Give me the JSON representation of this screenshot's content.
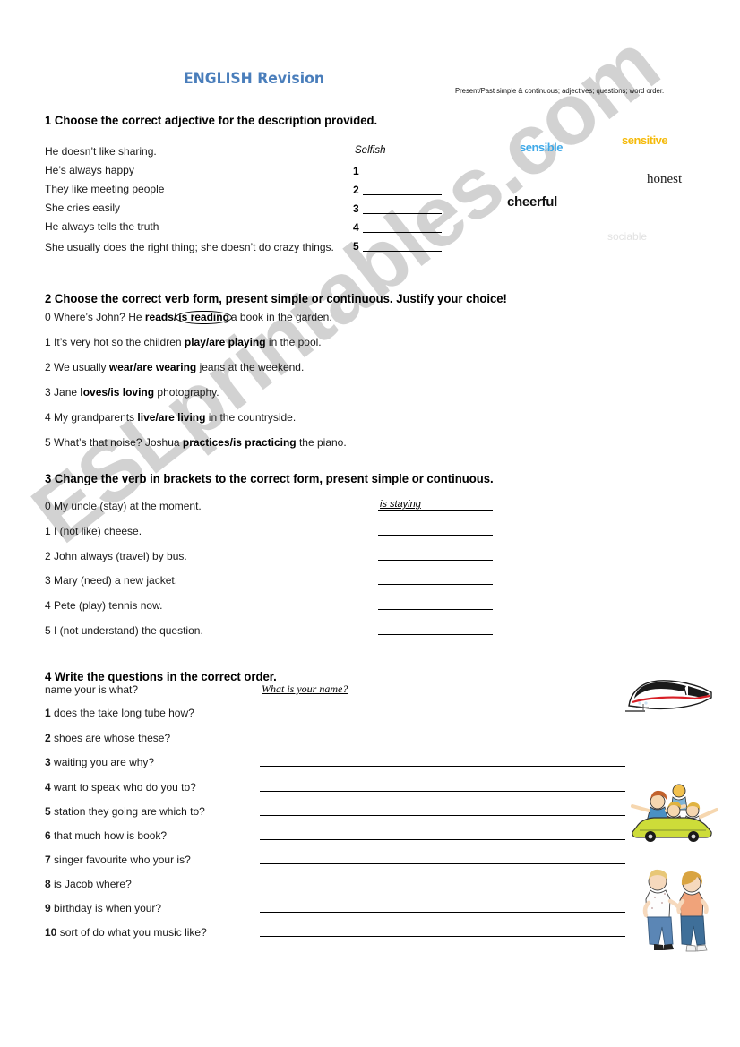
{
  "header": {
    "title": "ENGLISH Revision",
    "subtitle": "Present/Past simple & continuous; adjectives; questions; word order.",
    "title_color": "#4a7ebb"
  },
  "watermark": {
    "text": "ESLprintables.com",
    "color": "#d2d2d2"
  },
  "exercise1": {
    "heading": "1 Choose the correct adjective for the description provided.",
    "prompts": [
      "He doesn’t like sharing.",
      "He’s always happy",
      "They like meeting people",
      "She cries easily",
      "He always tells the truth",
      "She usually does the right thing; she doesn’t do crazy things."
    ],
    "example_answer": "Selfish",
    "answer_numbers": [
      "1",
      "2",
      "3",
      "4",
      "5"
    ],
    "wordbank": [
      {
        "word": "sensible",
        "color": "#3fa9e8"
      },
      {
        "word": "sensitive",
        "color": "#f5ba0a"
      },
      {
        "word": "honest",
        "color": "#1a1a1a"
      },
      {
        "word": "cheerful",
        "color": "#111111"
      },
      {
        "word": "sociable",
        "color": "#e2e2e2"
      }
    ]
  },
  "exercise2": {
    "heading": "2 Choose the correct verb form, present simple or continuous.  Justify your choice!",
    "items": [
      {
        "num": "0",
        "pre": "Where’s John? He ",
        "opt_a": "reads/",
        "opt_b": "is reading",
        "post": "a book in the garden.",
        "circled": true
      },
      {
        "num": "1",
        "pre": "It’s very hot so the children ",
        "opt_a": "play/are playing",
        "opt_b": "",
        "post": " in the pool.",
        "circled": false
      },
      {
        "num": "2",
        "pre": "We usually ",
        "opt_a": "wear/are wearing",
        "opt_b": "",
        "post": " jeans at the weekend.",
        "circled": false
      },
      {
        "num": "3",
        "pre": "Jane ",
        "opt_a": "loves/is loving",
        "opt_b": "",
        "post": " photography.",
        "circled": false
      },
      {
        "num": "4",
        "pre": "My grandparents ",
        "opt_a": "live/are living",
        "opt_b": "",
        "post": " in the countryside.",
        "circled": false
      },
      {
        "num": "5",
        "pre": "What’s that noise? Joshua ",
        "opt_a": "practices/is practicing",
        "opt_b": "",
        "post": " the piano.",
        "circled": false
      }
    ]
  },
  "exercise3": {
    "heading": "3 Change the verb in brackets to the correct form, present simple or continuous.",
    "items": [
      "0 My uncle (stay) at the moment.",
      "1 I (not like) cheese.",
      "2 John always (travel) by bus.",
      "3 Mary (need) a new jacket.",
      "4 Pete (play) tennis now.",
      "5 I (not understand) the question."
    ],
    "example_answer": "is staying"
  },
  "exercise4": {
    "heading": "4 Write the questions in the correct order.",
    "example_prompt": "name your is what?",
    "example_answer": "What is your name?",
    "items": [
      {
        "num": "1",
        "text": "does the take long tube how?"
      },
      {
        "num": "2",
        "text": "shoes are whose these?"
      },
      {
        "num": "3",
        "text": "waiting you are why?"
      },
      {
        "num": "4",
        "text": "want to speak who do you to?"
      },
      {
        "num": "5",
        "text": "station they going are which to?"
      },
      {
        "num": "6",
        "text": "that much how is book?"
      },
      {
        "num": "7",
        "text": "singer favourite who your is?"
      },
      {
        "num": "8",
        "text": "is Jacob where?"
      },
      {
        "num": "9",
        "text": "birthday is when your?"
      },
      {
        "num": "10",
        "text": "sort of do what you music like?"
      }
    ],
    "clipart": [
      {
        "name": "train-illustration",
        "label": "high-speed train"
      },
      {
        "name": "car-illustration",
        "label": "yellow convertible car with people"
      },
      {
        "name": "people-illustration",
        "label": "two people talking"
      }
    ]
  }
}
